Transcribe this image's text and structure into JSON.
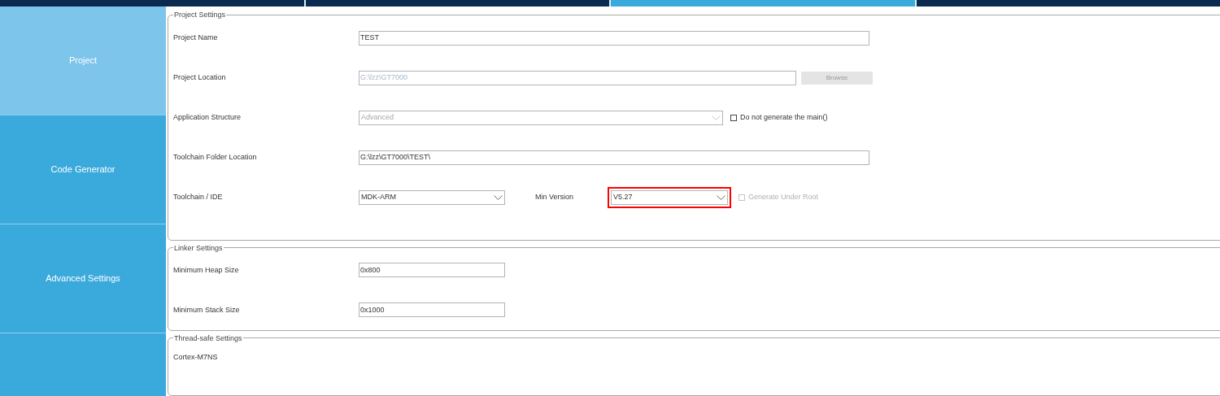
{
  "tabs": [
    {
      "selected": false
    },
    {
      "selected": false
    },
    {
      "selected": true
    },
    {
      "selected": false
    }
  ],
  "sidebar": {
    "items": [
      {
        "label": "Project",
        "selected": true
      },
      {
        "label": "Code Generator",
        "selected": false
      },
      {
        "label": "Advanced Settings",
        "selected": false
      }
    ]
  },
  "project_settings": {
    "title": "Project Settings",
    "fields": [
      {
        "kind": "text",
        "label": "Project Name",
        "value": "TEST",
        "disabled": false
      },
      {
        "kind": "text",
        "label": "Project Location",
        "value": "G:\\lzz\\GT7000",
        "disabled": true,
        "button": {
          "label": "Browse",
          "disabled": true
        }
      },
      {
        "kind": "dropdown",
        "label": "Application Structure",
        "value": "Advanced",
        "disabled": true,
        "checkbox": {
          "label": "Do not generate the main()",
          "checked": false,
          "disabled": false
        }
      },
      {
        "kind": "text",
        "label": "Toolchain Folder Location",
        "value": "G:\\lzz\\GT7000\\TEST\\",
        "disabled": false
      },
      {
        "kind": "dropdown",
        "label": "Toolchain / IDE",
        "value": "MDK-ARM",
        "disabled": false,
        "min_version": {
          "label": "Min Version",
          "value": "V5.27",
          "highlighted": true
        },
        "checkbox": {
          "label": "Generate Under Root",
          "checked": false,
          "disabled": true
        }
      }
    ]
  },
  "linker_settings": {
    "title": "Linker Settings",
    "fields": [
      {
        "label": "Minimum Heap Size",
        "value": "0x800"
      },
      {
        "label": "Minimum Stack Size",
        "value": "0x1000"
      }
    ]
  },
  "thread_safe_settings": {
    "title": "Thread-safe Settings",
    "core": "Cortex-M7NS"
  }
}
